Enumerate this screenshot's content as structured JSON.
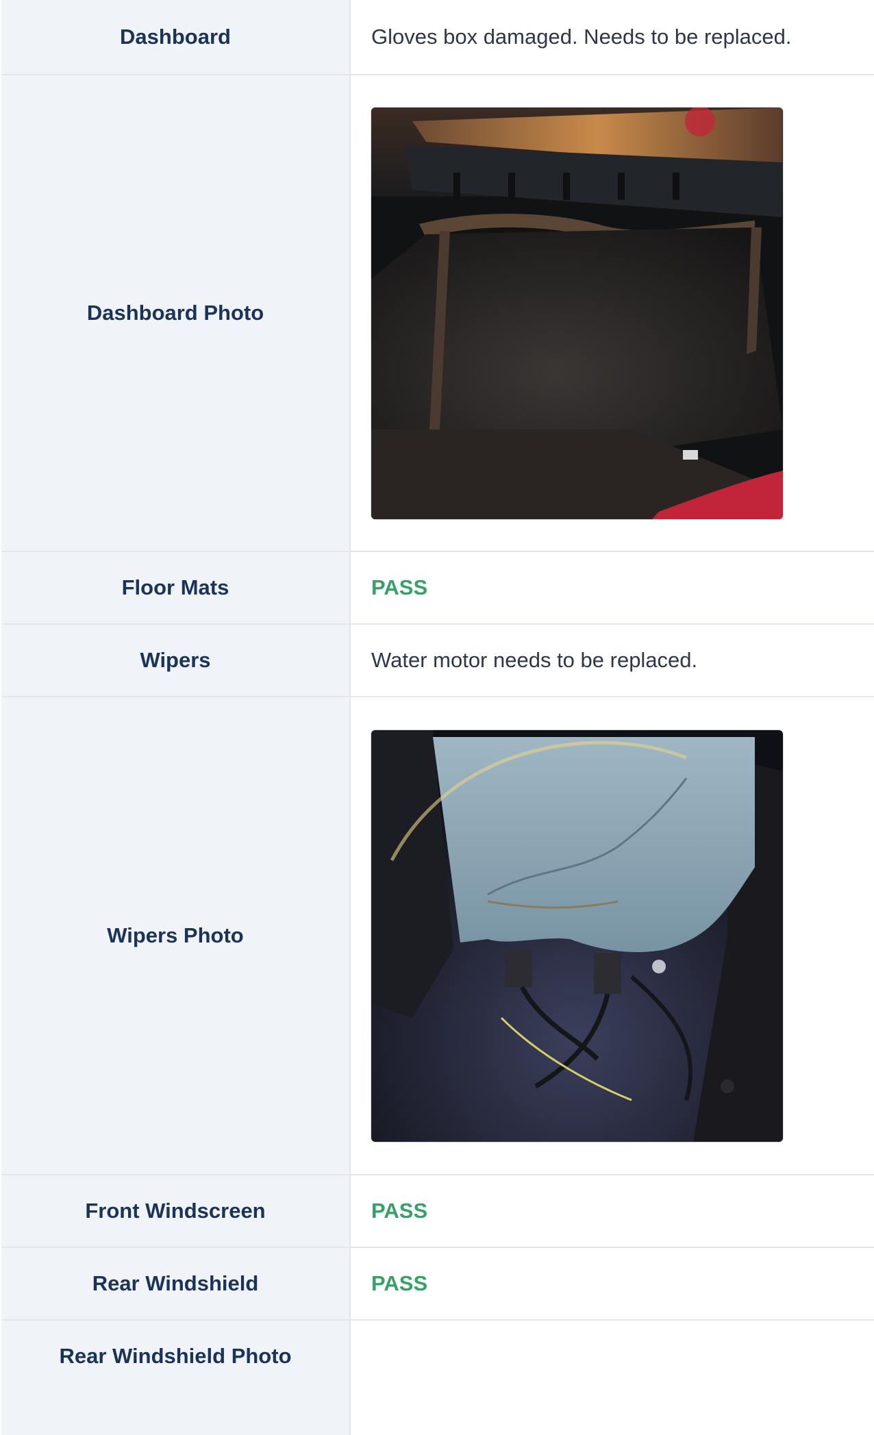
{
  "rows": [
    {
      "label": "Dashboard",
      "value": "Gloves box damaged. Needs to be replaced."
    },
    {
      "label": "Dashboard Photo",
      "photo": "glove-box-photo"
    },
    {
      "label": "Floor Mats",
      "status": "PASS"
    },
    {
      "label": "Wipers",
      "value": "Water motor needs to be replaced."
    },
    {
      "label": "Wipers Photo",
      "photo": "washer-reservoir-photo"
    },
    {
      "label": "Front Windscreen",
      "status": "PASS"
    },
    {
      "label": "Rear Windshield",
      "status": "PASS"
    },
    {
      "label": "Rear Windshield Photo"
    }
  ],
  "colors": {
    "label_bg": "#f0f3f8",
    "label_text": "#1b3357",
    "pass": "#38a169",
    "border": "#e1e6ec"
  }
}
